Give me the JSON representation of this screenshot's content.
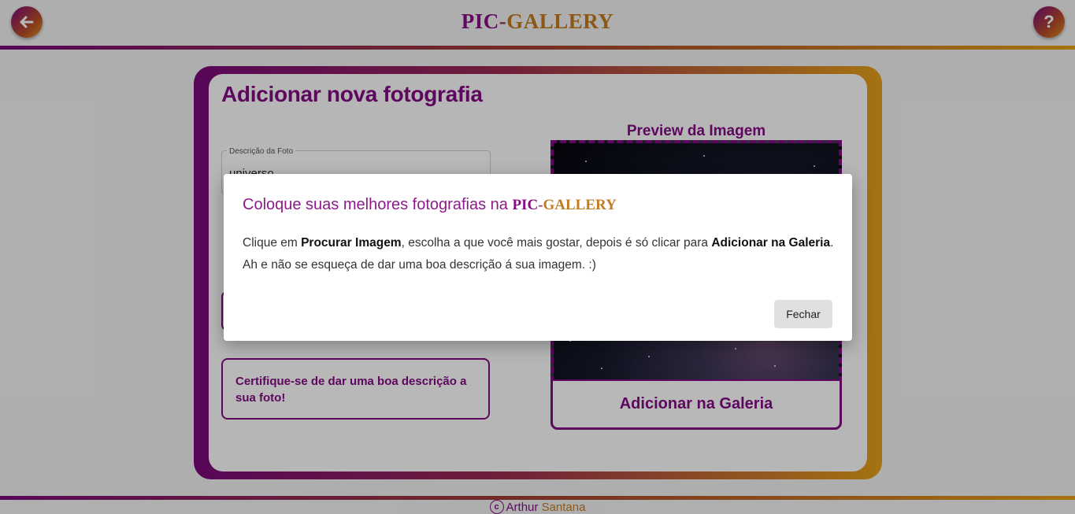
{
  "header": {
    "brand_pic": "PIC",
    "brand_dash": "-",
    "brand_gallery": "GALLERY",
    "back_icon": "arrow-left-icon",
    "help_label": "?"
  },
  "form": {
    "title": "Adicionar nova fotografia",
    "description_label": "Descrição da Foto",
    "description_value": "universo",
    "tip": "Certifique-se de dar uma boa descrição a sua foto!"
  },
  "preview": {
    "title": "Preview da Imagem",
    "add_button": "Adicionar na Galeria"
  },
  "footer": {
    "copyright_symbol": "c",
    "first_name": "Arthur",
    "last_name": "Santana"
  },
  "modal": {
    "title_prefix": "Coloque suas melhores fotografias na",
    "title_pic": "PIC",
    "title_dash": "-",
    "title_gallery": "GALLERY",
    "body_1": "Clique em ",
    "body_bold_1": "Procurar Imagem",
    "body_2": ", escolha a que você mais gostar, depois é só clicar para ",
    "body_bold_2": "Adicionar na Galeria",
    "body_3": ".",
    "body_line2": "Ah e não se esqueça de dar uma boa descrição á sua imagem. :)",
    "close_button": "Fechar"
  },
  "colors": {
    "purple": "#830b83",
    "orange": "#e3a018"
  }
}
